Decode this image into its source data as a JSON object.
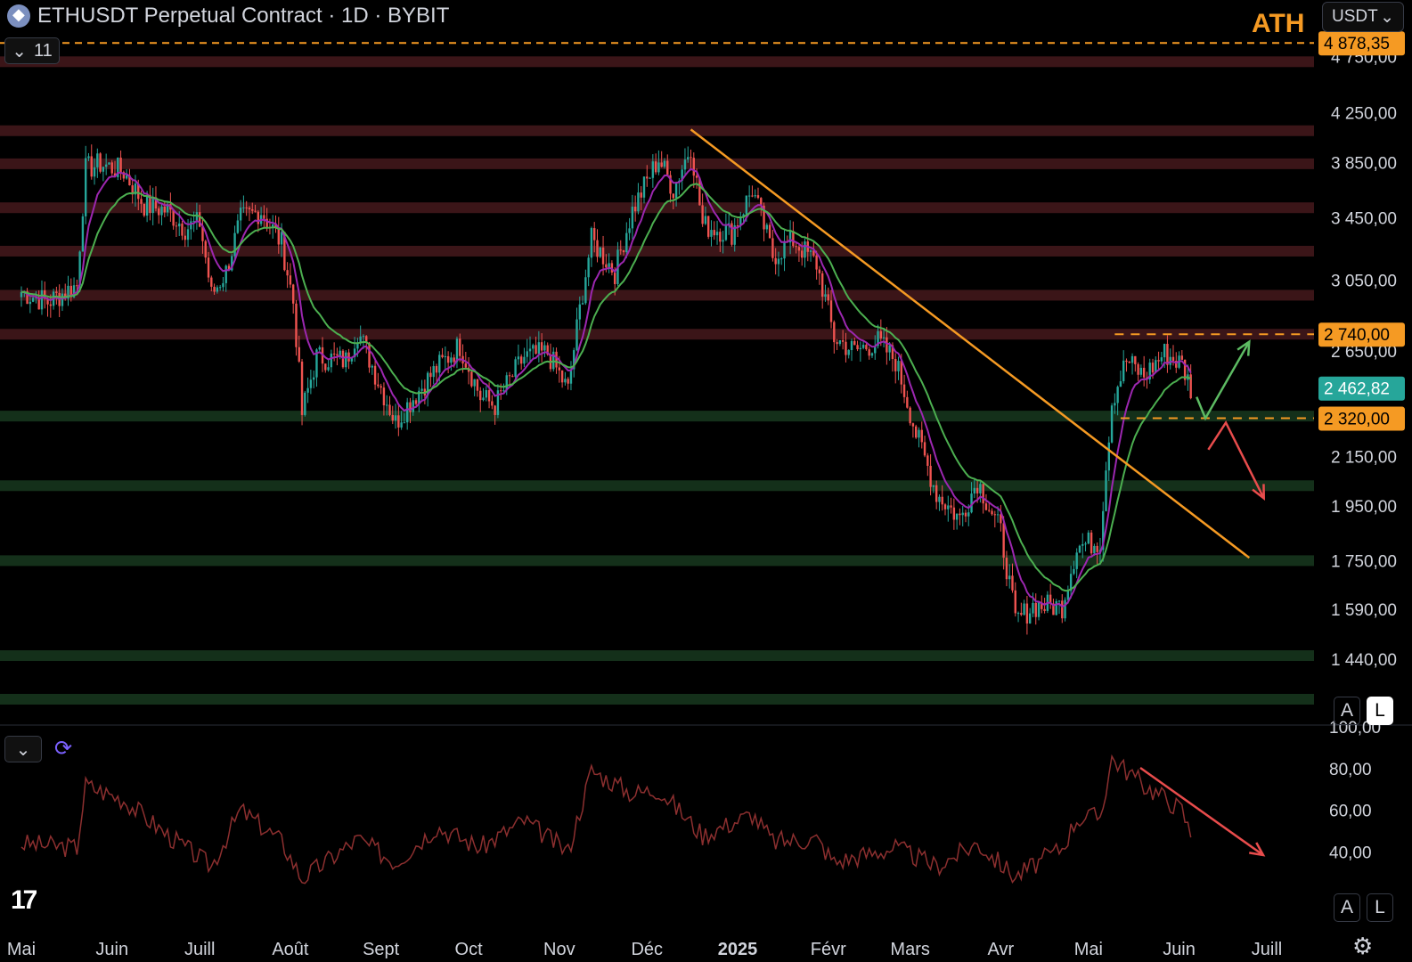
{
  "header": {
    "title": "ETHUSDT Perpetual Contract · 1D · BYBIT",
    "currency": "USDT",
    "ath_label": "ATH",
    "indicator_count": "11"
  },
  "chart_data": [
    {
      "type": "candlestick",
      "title": "ETHUSDT Perpetual Contract · 1D · BYBIT",
      "y_scale": "log",
      "ylim": [
        1330,
        4880
      ],
      "y_ticks": [
        {
          "value": 4750,
          "label": "4 750,00"
        },
        {
          "value": 4250,
          "label": "4 250,00"
        },
        {
          "value": 3850,
          "label": "3 850,00"
        },
        {
          "value": 3450,
          "label": "3 450,00"
        },
        {
          "value": 3050,
          "label": "3 050,00"
        },
        {
          "value": 2650,
          "label": "2 650,00"
        },
        {
          "value": 2150,
          "label": "2 150,00"
        },
        {
          "value": 1950,
          "label": "1 950,00"
        },
        {
          "value": 1750,
          "label": "1 750,00"
        },
        {
          "value": 1590,
          "label": "1 590,00"
        },
        {
          "value": 1440,
          "label": "1 440,00"
        }
      ],
      "price_labels": [
        {
          "value": 4878.35,
          "label": "4 878,35",
          "color": "#f59a23",
          "style": "dashed"
        },
        {
          "value": 2740,
          "label": "2 740,00",
          "color": "#f59a23",
          "style": "dashed"
        },
        {
          "value": 2462.82,
          "label": "2 462,82",
          "color": "#26a69a",
          "style": "current"
        },
        {
          "value": 2320,
          "label": "2 320,00",
          "color": "#f59a23",
          "style": "dashed"
        }
      ],
      "x_labels": [
        "Mai",
        "Juin",
        "Juill",
        "Août",
        "Sept",
        "Oct",
        "Nov",
        "Déc",
        "2025",
        "Févr",
        "Mars",
        "Avr",
        "Mai",
        "Juin",
        "Juill"
      ],
      "resistance_zones": [
        4700,
        4100,
        3840,
        3520,
        3230,
        2960,
        2740
      ],
      "support_zones": [
        2330,
        2030,
        1750,
        1450,
        1330
      ],
      "trendline": {
        "from": [
          "2024-12-16",
          4110
        ],
        "to": [
          "2025-06-25",
          1760
        ]
      },
      "close_series": [
        [
          "2024-05-01",
          2980
        ],
        [
          "2024-05-10",
          2920
        ],
        [
          "2024-05-20",
          3020
        ],
        [
          "2024-05-23",
          3800
        ],
        [
          "2024-05-28",
          3840
        ],
        [
          "2024-06-05",
          3780
        ],
        [
          "2024-06-12",
          3540
        ],
        [
          "2024-06-20",
          3500
        ],
        [
          "2024-06-26",
          3380
        ],
        [
          "2024-07-01",
          3420
        ],
        [
          "2024-07-05",
          2960
        ],
        [
          "2024-07-10",
          3100
        ],
        [
          "2024-07-15",
          3440
        ],
        [
          "2024-07-22",
          3500
        ],
        [
          "2024-07-29",
          3280
        ],
        [
          "2024-08-02",
          2920
        ],
        [
          "2024-08-05",
          2340
        ],
        [
          "2024-08-10",
          2620
        ],
        [
          "2024-08-20",
          2600
        ],
        [
          "2024-08-24",
          2760
        ],
        [
          "2024-08-31",
          2500
        ],
        [
          "2024-09-06",
          2300
        ],
        [
          "2024-09-10",
          2380
        ],
        [
          "2024-09-20",
          2560
        ],
        [
          "2024-09-28",
          2680
        ],
        [
          "2024-10-05",
          2420
        ],
        [
          "2024-10-10",
          2380
        ],
        [
          "2024-10-20",
          2620
        ],
        [
          "2024-10-28",
          2640
        ],
        [
          "2024-11-04",
          2450
        ],
        [
          "2024-11-12",
          3300
        ],
        [
          "2024-11-20",
          3100
        ],
        [
          "2024-11-26",
          3500
        ],
        [
          "2024-12-05",
          3880
        ],
        [
          "2024-12-10",
          3650
        ],
        [
          "2024-12-16",
          3980
        ],
        [
          "2024-12-20",
          3400
        ],
        [
          "2024-12-30",
          3350
        ],
        [
          "2025-01-06",
          3650
        ],
        [
          "2025-01-13",
          3200
        ],
        [
          "2025-01-20",
          3300
        ],
        [
          "2025-01-28",
          3150
        ],
        [
          "2025-02-03",
          2720
        ],
        [
          "2025-02-10",
          2650
        ],
        [
          "2025-02-18",
          2700
        ],
        [
          "2025-02-24",
          2600
        ],
        [
          "2025-03-03",
          2250
        ],
        [
          "2025-03-10",
          2000
        ],
        [
          "2025-03-18",
          1900
        ],
        [
          "2025-03-24",
          2050
        ],
        [
          "2025-04-01",
          1850
        ],
        [
          "2025-04-06",
          1550
        ],
        [
          "2025-04-12",
          1600
        ],
        [
          "2025-04-22",
          1600
        ],
        [
          "2025-04-27",
          1800
        ],
        [
          "2025-05-05",
          1820
        ],
        [
          "2025-05-09",
          2400
        ],
        [
          "2025-05-14",
          2600
        ],
        [
          "2025-05-20",
          2520
        ],
        [
          "2025-05-27",
          2640
        ],
        [
          "2025-06-02",
          2580
        ],
        [
          "2025-06-05",
          2462.82
        ]
      ]
    },
    {
      "type": "line",
      "ylim": [
        20,
        100
      ],
      "y_ticks": [
        {
          "value": 100,
          "label": "100,00"
        },
        {
          "value": 80,
          "label": "80,00"
        },
        {
          "value": 60,
          "label": "60,00"
        },
        {
          "value": 40,
          "label": "40,00"
        }
      ],
      "x_labels": [
        "Mai",
        "Juin",
        "Juill",
        "Août",
        "Sept",
        "Oct",
        "Nov",
        "Déc",
        "2025",
        "Févr",
        "Mars",
        "Avr",
        "Mai",
        "Juin",
        "Juill"
      ],
      "series": [
        {
          "color": "#8c2f2f",
          "values": [
            [
              "2024-05-01",
              44
            ],
            [
              "2024-05-20",
              42
            ],
            [
              "2024-05-23",
              72
            ],
            [
              "2024-06-05",
              65
            ],
            [
              "2024-06-20",
              48
            ],
            [
              "2024-07-05",
              33
            ],
            [
              "2024-07-15",
              60
            ],
            [
              "2024-07-29",
              45
            ],
            [
              "2024-08-05",
              27
            ],
            [
              "2024-08-24",
              46
            ],
            [
              "2024-09-06",
              35
            ],
            [
              "2024-09-20",
              52
            ],
            [
              "2024-10-05",
              42
            ],
            [
              "2024-10-20",
              55
            ],
            [
              "2024-11-04",
              40
            ],
            [
              "2024-11-12",
              79
            ],
            [
              "2024-11-26",
              68
            ],
            [
              "2024-12-05",
              70
            ],
            [
              "2024-12-20",
              48
            ],
            [
              "2025-01-06",
              58
            ],
            [
              "2025-01-13",
              45
            ],
            [
              "2025-01-28",
              46
            ],
            [
              "2025-02-03",
              35
            ],
            [
              "2025-02-24",
              42
            ],
            [
              "2025-03-10",
              33
            ],
            [
              "2025-03-24",
              44
            ],
            [
              "2025-04-06",
              28
            ],
            [
              "2025-04-22",
              42
            ],
            [
              "2025-04-27",
              56
            ],
            [
              "2025-05-05",
              57
            ],
            [
              "2025-05-09",
              85
            ],
            [
              "2025-05-20",
              72
            ],
            [
              "2025-05-27",
              66
            ],
            [
              "2025-06-02",
              60
            ],
            [
              "2025-06-05",
              48
            ]
          ]
        }
      ]
    }
  ],
  "colors": {
    "up": "#26a69a",
    "down": "#ef5350",
    "trendline": "#f59a23",
    "ema_fast": "#9c27b0",
    "ema_slow": "#4caf50",
    "resistance": "#3b1518",
    "support": "#14301a"
  },
  "scale_buttons": {
    "a": "A",
    "l": "L"
  },
  "icons": [
    "chevron-down-icon",
    "sync-icon",
    "tradingview-logo",
    "settings-icon"
  ]
}
